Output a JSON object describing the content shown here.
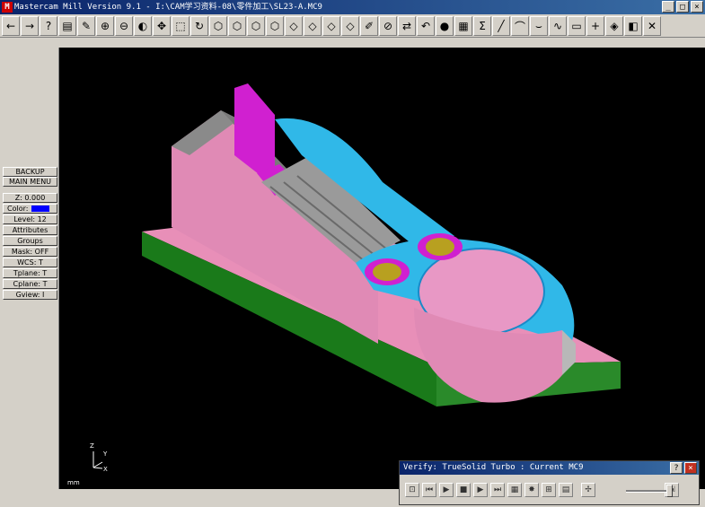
{
  "window": {
    "title": "Mastercam Mill Version 9.1 - I:\\CAM学习资料-08\\零件加工\\SL23-A.MC9",
    "app_icon_letter": "M",
    "minimize": "_",
    "maximize": "□",
    "close": "×"
  },
  "toolbar": {
    "icons": [
      "back-arrow-icon",
      "forward-arrow-icon",
      "help-icon",
      "calculator-icon",
      "eraser-icon",
      "zoom-window-icon",
      "zoom-out-icon",
      "unzoom-icon",
      "pan-icon",
      "zoom-fit-icon",
      "repaint-icon",
      "view-top-icon",
      "view-front-icon",
      "view-side-icon",
      "view-iso-icon",
      "cube-top-icon",
      "cube-front-icon",
      "cube-side-icon",
      "cube-iso-icon",
      "shade-icon",
      "delete-icon",
      "transform-icon",
      "undo-icon",
      "sphere-icon",
      "layers-icon",
      "sigma-icon",
      "line-icon",
      "arc-icon",
      "fillet-icon",
      "spline-icon",
      "rectangle-icon",
      "point-icon",
      "drafting-icon",
      "solids-icon",
      "trim-icon"
    ],
    "glyphs": [
      "←",
      "→",
      "?",
      "▤",
      "✎",
      "⊕",
      "⊖",
      "◐",
      "✥",
      "⬚",
      "↻",
      "⬡",
      "⬡",
      "⬡",
      "⬡",
      "◇",
      "◇",
      "◇",
      "◇",
      "✐",
      "⊘",
      "⇄",
      "↶",
      "●",
      "▦",
      "Σ",
      "╱",
      "⌒",
      "⌣",
      "∿",
      "▭",
      "+",
      "◈",
      "◧",
      "✕"
    ]
  },
  "sidebar": {
    "backup": "BACKUP",
    "main_menu": "MAIN MENU",
    "z": "Z:  0.000",
    "color_label": "Color:",
    "color_value": "#0000ff",
    "level": "Level: 12",
    "attributes": "Attributes",
    "groups": "Groups",
    "mask": "Mask:  OFF",
    "wcs": "WCS:   T",
    "tplane": "Tplane:  T",
    "cplane": "Cplane:  T",
    "gview": "Gview:   I"
  },
  "viewport": {
    "axis_z": "Z",
    "axis_y": "Y",
    "axis_x": "X",
    "units": "mm"
  },
  "verify": {
    "title": "Verify: TrueSolid Turbo : Current MC9",
    "help": "?",
    "close": "×",
    "controls": [
      "⊡",
      "⏮",
      "▶",
      "■",
      "▶",
      "⏭",
      "▦",
      "✸",
      "⊞",
      "▤",
      "✢",
      "⇲"
    ],
    "control_names": [
      "options-icon",
      "rewind-icon",
      "play-icon",
      "stop-icon",
      "step-icon",
      "fast-forward-icon",
      "display-icon",
      "tool-icon",
      "model-icon",
      "info-icon",
      "speed-icon",
      "exit-icon"
    ]
  }
}
